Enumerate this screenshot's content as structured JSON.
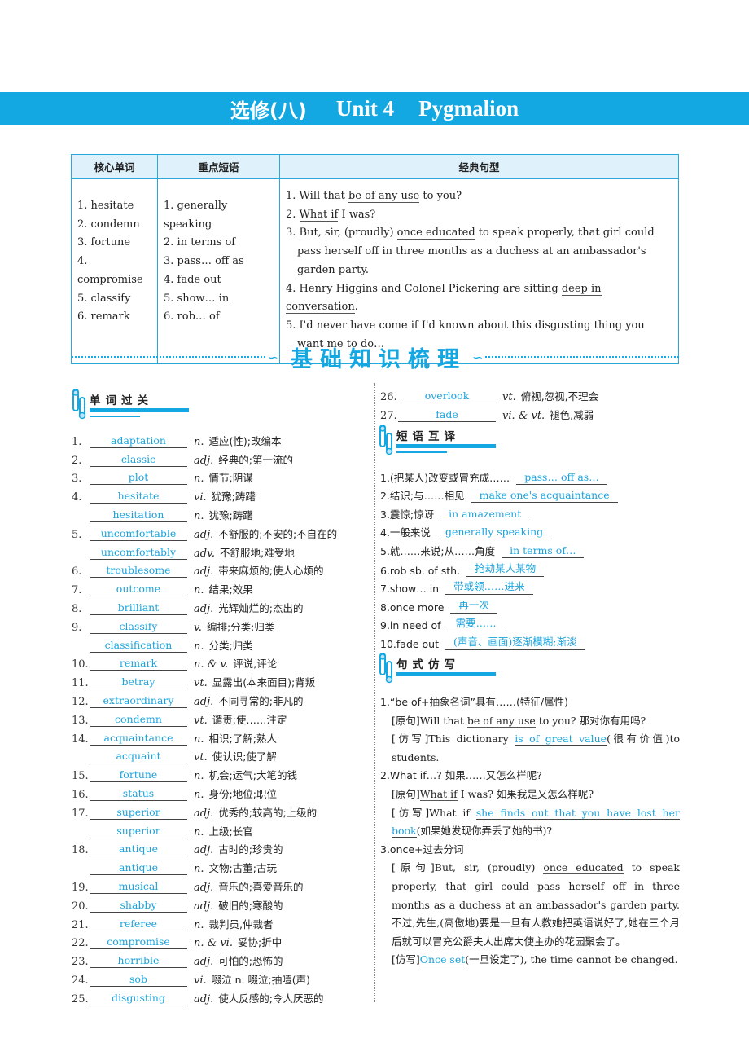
{
  "banner": {
    "cn": "选修(八)",
    "unit": "Unit 4",
    "name": "Pygmalion"
  },
  "summary": {
    "headers": [
      "核心单词",
      "重点短语",
      "经典句型"
    ],
    "words": [
      "1. hesitate",
      "2. condemn",
      "3. fortune",
      "4. compromise",
      "5. classify",
      "6. remark"
    ],
    "phrases": [
      "1. generally speaking",
      "2. in terms of",
      "3. pass… off as",
      "4. fade out",
      "5. show… in",
      "6. rob… of"
    ],
    "sentences": [
      {
        "pre": "1. Will that ",
        "ul": "be of any use",
        "post": " to you?"
      },
      {
        "pre": "2. ",
        "ul": "What if",
        "post": " I was?"
      },
      {
        "pre": "3. But, sir, (proudly) ",
        "ul": "once educated",
        "post": " to speak properly, that girl could pass herself off in three months as a duchess at an ambassador's garden party."
      },
      {
        "pre": "4. Henry Higgins and Colonel Pickering are sitting ",
        "ul": "deep in conversation",
        "post": "."
      },
      {
        "pre": "5. ",
        "ul": "I'd never have come if I'd known",
        "post": " about this disgusting thing you want me to do…"
      }
    ]
  },
  "section_title": "基础知识梳理",
  "vocab_section": {
    "title": "单词过关",
    "left_items": [
      {
        "num": "1.",
        "word": "adaptation",
        "pos": "n.",
        "meaning": "适应(性);改编本"
      },
      {
        "num": "2.",
        "word": "classic",
        "pos": "adj.",
        "meaning": "经典的;第一流的"
      },
      {
        "num": "3.",
        "word": "plot",
        "pos": "n.",
        "meaning": "情节;阴谋"
      },
      {
        "num": "4.",
        "word": "hesitate",
        "pos": "vi.",
        "meaning": "犹豫;踌躇"
      },
      {
        "num": "",
        "word": "hesitation",
        "pos": "n.",
        "meaning": "犹豫;踌躇"
      },
      {
        "num": "5.",
        "word": "uncomfortable",
        "pos": "adj.",
        "meaning": "不舒服的;不安的;不自在的"
      },
      {
        "num": "",
        "word": "uncomfortably",
        "pos": "adv.",
        "meaning": "不舒服地;难受地"
      },
      {
        "num": "6.",
        "word": "troublesome",
        "pos": "adj.",
        "meaning": "带来麻烦的;使人心烦的"
      },
      {
        "num": "7.",
        "word": "outcome",
        "pos": "n.",
        "meaning": "结果;效果"
      },
      {
        "num": "8.",
        "word": "brilliant",
        "pos": "adj.",
        "meaning": "光辉灿烂的;杰出的"
      },
      {
        "num": "9.",
        "word": "classify",
        "pos": "v.",
        "meaning": "编排;分类;归类"
      },
      {
        "num": "",
        "word": "classification",
        "pos": "n.",
        "meaning": "分类;归类"
      },
      {
        "num": "10.",
        "word": "remark",
        "pos": "n. & v.",
        "meaning": "评说,评论"
      },
      {
        "num": "11.",
        "word": "betray",
        "pos": "vt.",
        "meaning": "显露出(本来面目);背叛"
      },
      {
        "num": "12.",
        "word": "extraordinary",
        "pos": "adj.",
        "meaning": "不同寻常的;非凡的"
      },
      {
        "num": "13.",
        "word": "condemn",
        "pos": "vt.",
        "meaning": "谴责;使……注定"
      },
      {
        "num": "14.",
        "word": "acquaintance",
        "pos": "n.",
        "meaning": "相识;了解;熟人"
      },
      {
        "num": "",
        "word": "acquaint",
        "pos": "vt.",
        "meaning": "使认识;使了解"
      },
      {
        "num": "15.",
        "word": "fortune",
        "pos": "n.",
        "meaning": "机会;运气;大笔的钱"
      },
      {
        "num": "16.",
        "word": "status",
        "pos": "n.",
        "meaning": "身份;地位;职位"
      },
      {
        "num": "17.",
        "word": "superior",
        "pos": "adj.",
        "meaning": "优秀的;较高的;上级的"
      },
      {
        "num": "",
        "word": "superior",
        "pos": "n.",
        "meaning": "上级;长官"
      },
      {
        "num": "18.",
        "word": "antique",
        "pos": "adj.",
        "meaning": "古时的;珍贵的"
      },
      {
        "num": "",
        "word": "antique",
        "pos": "n.",
        "meaning": "文物;古董;古玩"
      },
      {
        "num": "19.",
        "word": "musical",
        "pos": "adj.",
        "meaning": "音乐的;喜爱音乐的"
      },
      {
        "num": "20.",
        "word": "shabby",
        "pos": "adj.",
        "meaning": "破旧的;寒酸的"
      },
      {
        "num": "21.",
        "word": "referee",
        "pos": "n.",
        "meaning": "裁判员,仲裁者"
      },
      {
        "num": "22.",
        "word": "compromise",
        "pos": "n. & vi.",
        "meaning": "妥协;折中"
      },
      {
        "num": "23.",
        "word": "horrible",
        "pos": "adj.",
        "meaning": "可怕的;恐怖的"
      },
      {
        "num": "24.",
        "word": "sob",
        "pos": "vi.",
        "meaning": "啜泣  n. 啜泣;抽噎(声)"
      },
      {
        "num": "25.",
        "word": "disgusting",
        "pos": "adj.",
        "meaning": "使人反感的;令人厌恶的"
      }
    ],
    "right_items": [
      {
        "num": "26.",
        "word": "overlook",
        "pos": "vt.",
        "meaning": "俯视,忽视,不理会"
      },
      {
        "num": "27.",
        "word": "fade",
        "pos": "vi. & vt.",
        "meaning": "褪色,减弱"
      }
    ]
  },
  "phrase_section": {
    "title": "短语互译",
    "items": [
      {
        "q": "1.(把某人)改变或冒充成……",
        "a": "pass… off as…"
      },
      {
        "q": "2.结识;与……相见",
        "a": "make one's acquaintance"
      },
      {
        "q": "3.震惊;惊讶",
        "a": "in amazement"
      },
      {
        "q": "4.一般来说",
        "a": "generally speaking"
      },
      {
        "q": "5.就……来说;从……角度",
        "a": "in terms of…"
      },
      {
        "q": "6.rob sb. of sth.",
        "a": "抢劫某人某物"
      },
      {
        "q": "7.show… in",
        "a": "带或领……进来"
      },
      {
        "q": "8.once more",
        "a": "再一次"
      },
      {
        "q": "9.in need of",
        "a": "需要……"
      },
      {
        "q": "10.fade out",
        "a": "(声音、画面)逐渐模糊;渐淡"
      }
    ]
  },
  "sentence_section": {
    "title": "句式仿写",
    "items": [
      {
        "head": "1.“be of+抽象名词”具有……(特征/属性)",
        "orig_tag": "[原句]",
        "orig_pre": "Will that ",
        "orig_ul": "be of any use",
        "orig_post": " to you? 那对你有用吗?",
        "imit_tag": "[仿写]",
        "imit_pre": "This dictionary ",
        "imit_ans": "is of great value",
        "imit_post": "(很有价值)to students."
      },
      {
        "head": "2.What if…? 如果……又怎么样呢?",
        "orig_tag": "[原句]",
        "orig_pre": "",
        "orig_ul": "What if",
        "orig_post": " I was? 如果我是又怎么样呢?",
        "imit_tag": "[仿写]",
        "imit_pre": "What if ",
        "imit_ans": "she finds out that you have lost her book",
        "imit_post": "(如果她发现你弄丢了她的书)?"
      },
      {
        "head": "3.once+过去分词",
        "orig_tag": "[原句]",
        "orig_pre": "But, sir, (proudly) ",
        "orig_ul": "once educated",
        "orig_post": " to speak properly, that girl could pass herself off in three months as a duchess at an ambassador's garden party. 不过,先生,(高傲地)要是一旦有人教她把英语说好了,她在三个月后就可以冒充公爵夫人出席大使主办的花园聚会了。",
        "imit_tag": "[仿写]",
        "imit_pre": "",
        "imit_ans": "Once set",
        "imit_post": "(一旦设定了), the time cannot be changed."
      }
    ]
  },
  "colors": {
    "accent": "#13a8e2",
    "answer": "#1aa3dd",
    "header_bg": "#dff1fa"
  }
}
